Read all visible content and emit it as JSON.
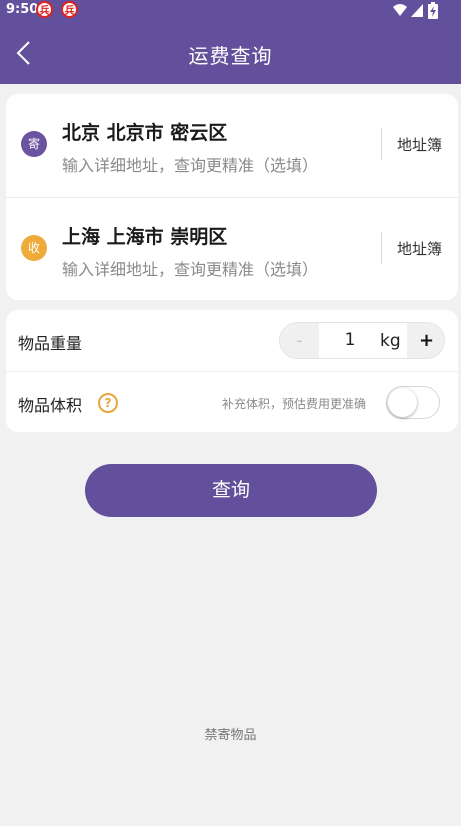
{
  "status_bar": {
    "time": "9:50",
    "notification_glyph": "兵"
  },
  "header": {
    "title": "运费查询"
  },
  "sender": {
    "badge": "寄",
    "region": "北京 北京市 密云区",
    "detail_placeholder": "输入详细地址，查询更精准（选填）",
    "addressbook_label": "地址簿"
  },
  "receiver": {
    "badge": "收",
    "region": "上海 上海市 崇明区",
    "detail_placeholder": "输入详细地址，查询更精准（选填）",
    "addressbook_label": "地址簿"
  },
  "weight": {
    "label": "物品重量",
    "value": "1",
    "unit": "kg",
    "minus": "-",
    "plus": "+"
  },
  "volume": {
    "label": "物品体积",
    "help": "?",
    "hint": "补充体积，预估费用更准确",
    "enabled": false
  },
  "query_button": "查询",
  "forbidden_link": "禁寄物品",
  "colors": {
    "brand": "#63509c",
    "sender_badge": "#6a54a0",
    "receiver_badge": "#eeab3a",
    "help": "#e8a53a",
    "background": "#f2f1f2"
  }
}
